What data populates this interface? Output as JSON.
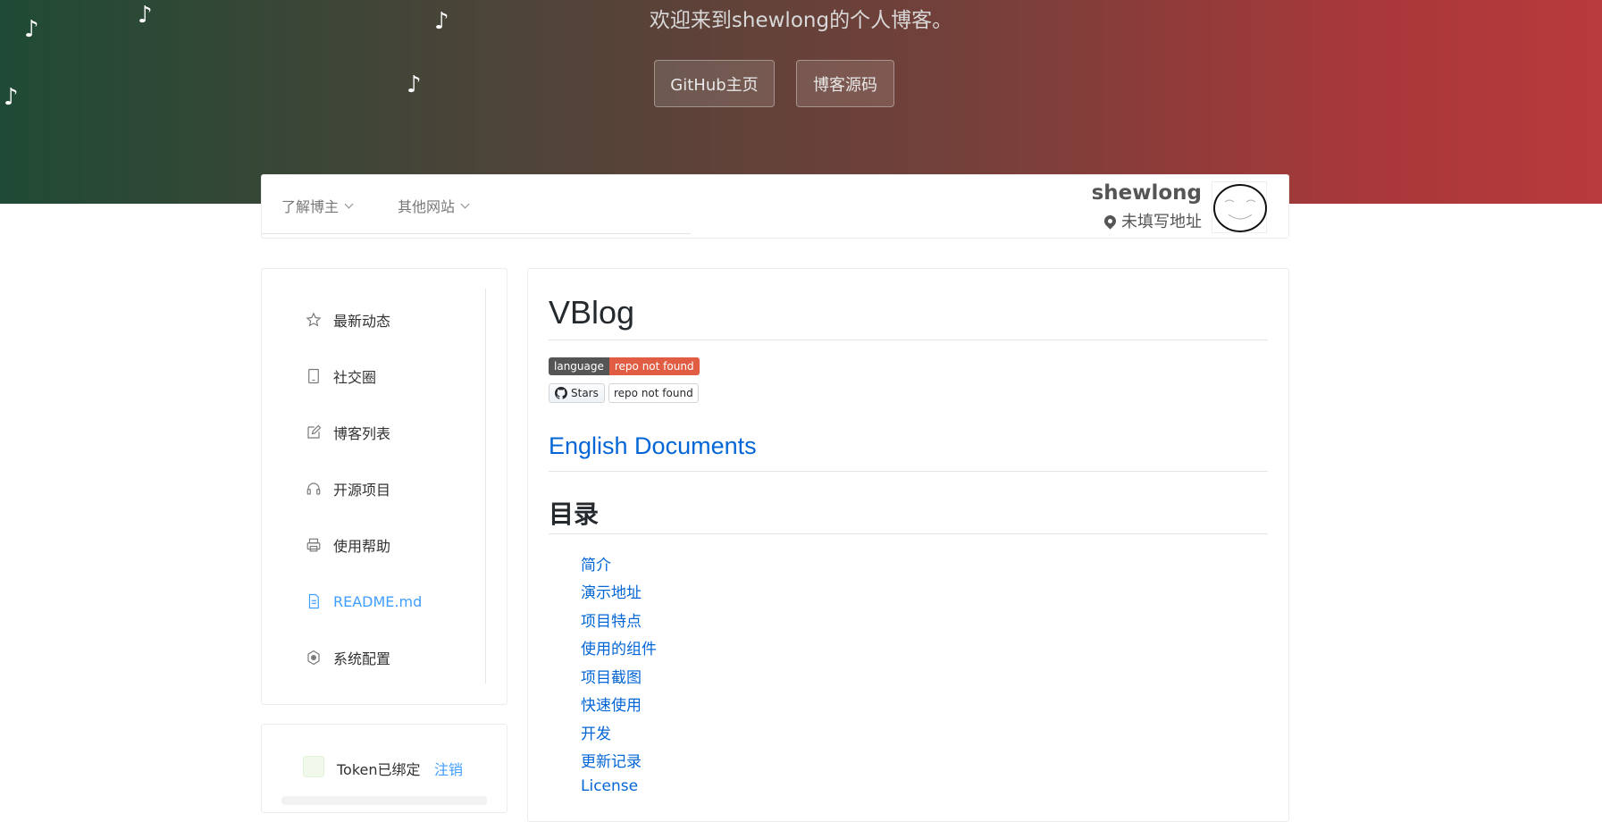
{
  "banner": {
    "welcome": "欢迎来到shewlong的个人博客。",
    "buttons": [
      {
        "label": "GitHub主页"
      },
      {
        "label": "博客源码"
      }
    ],
    "note_glyph": "♪",
    "gradient_colors": [
      "#1f4a35",
      "#4b4438",
      "#74403a",
      "#b83a3c"
    ]
  },
  "navbar": {
    "menus": [
      {
        "label": "了解博主"
      },
      {
        "label": "其他网站"
      }
    ],
    "profile": {
      "name": "shewlong",
      "location": "未填写地址"
    }
  },
  "sidebar": {
    "items": [
      {
        "label": "最新动态",
        "icon": "star-icon"
      },
      {
        "label": "社交圈",
        "icon": "tablet-icon"
      },
      {
        "label": "博客列表",
        "icon": "edit-icon"
      },
      {
        "label": "开源项目",
        "icon": "headset-icon"
      },
      {
        "label": "使用帮助",
        "icon": "printer-icon"
      },
      {
        "label": "README.md",
        "icon": "document-icon",
        "active": true
      },
      {
        "label": "系统配置",
        "icon": "setting-icon"
      }
    ],
    "active_color": "#409eff"
  },
  "token": {
    "status": "Token已绑定",
    "logout": "注销"
  },
  "readme": {
    "title": "VBlog",
    "badges": {
      "language_label": "language",
      "language_value": "repo not found",
      "stars_label": "Stars",
      "stars_value": "repo not found"
    },
    "english_docs": "English Documents",
    "toc_heading": "目录",
    "toc": [
      "简介",
      "演示地址",
      "项目特点",
      "使用的组件",
      "项目截图",
      "快速使用",
      "开发",
      "更新记录",
      "License"
    ],
    "link_color": "#0366d6"
  }
}
